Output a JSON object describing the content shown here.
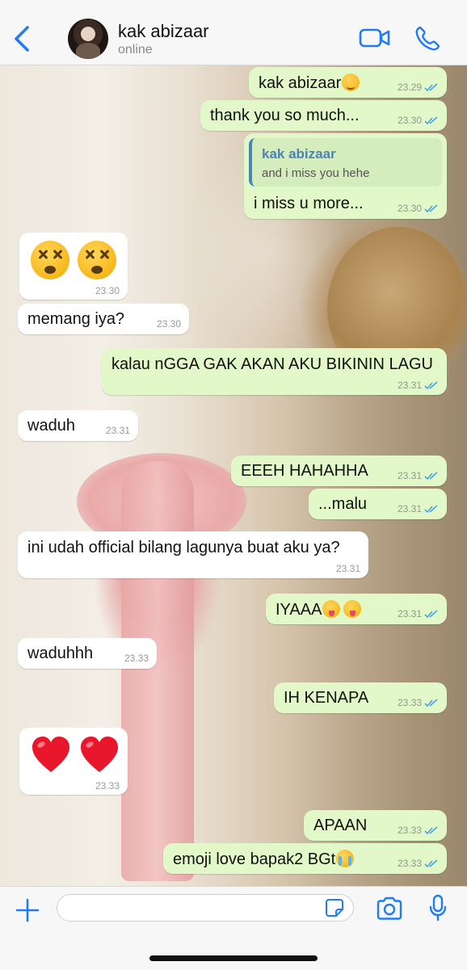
{
  "header": {
    "contact_name": "kak abizaar",
    "status": "online",
    "icons": {
      "back": "chevron-left-icon",
      "video": "video-camera-icon",
      "call": "phone-icon"
    },
    "accent_color": "#1f7cf5"
  },
  "messages": [
    {
      "dir": "out",
      "text": "kak abizaar",
      "emoji": "smile",
      "time": "23.29"
    },
    {
      "dir": "out",
      "text": "thank you so much...",
      "time": "23.30"
    },
    {
      "dir": "out",
      "quote_author": "kak abizaar",
      "quote_text": "and i miss you hehe",
      "text": "i miss u more...",
      "time": "23.30"
    },
    {
      "dir": "in",
      "emoji_only": "dizzy-face x2",
      "time": "23.30"
    },
    {
      "dir": "in",
      "text": "memang iya?",
      "time": "23.30"
    },
    {
      "dir": "out",
      "text": "kalau nGGA GAK AKAN AKU BIKININ LAGU",
      "time": "23.31"
    },
    {
      "dir": "in",
      "text": "waduh",
      "time": "23.31"
    },
    {
      "dir": "out",
      "text": "EEEH HAHAHHA",
      "time": "23.31"
    },
    {
      "dir": "out",
      "text": "...malu",
      "time": "23.31"
    },
    {
      "dir": "in",
      "text": "ini udah official bilang lagunya buat aku ya?",
      "time": "23.31"
    },
    {
      "dir": "out",
      "text": "IYAAA",
      "emoji": "tongue x2",
      "time": "23.31"
    },
    {
      "dir": "in",
      "text": "waduhhh",
      "time": "23.33"
    },
    {
      "dir": "out",
      "text": "IH KENAPA",
      "time": "23.33"
    },
    {
      "dir": "in",
      "emoji_only": "red-heart x2",
      "time": "23.33"
    },
    {
      "dir": "out",
      "text": "APAAN",
      "time": "23.33"
    },
    {
      "dir": "out",
      "text": "emoji love bapak2 BGt",
      "emoji": "crying",
      "time": "23.33"
    }
  ],
  "composer": {
    "placeholder": "",
    "icons": {
      "attach": "plus-icon",
      "sticker": "sticker-icon",
      "camera": "camera-icon",
      "mic": "microphone-icon"
    }
  },
  "colors": {
    "outgoing_bubble": "#e2f8c8",
    "incoming_bubble": "#ffffff",
    "read_ticks": "#4aa3e0"
  }
}
